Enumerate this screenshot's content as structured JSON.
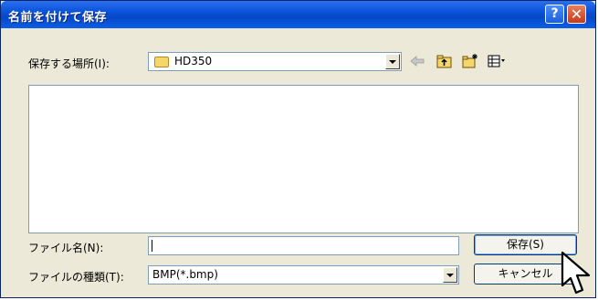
{
  "window": {
    "title": "名前を付けて保存",
    "help_glyph": "?",
    "close_glyph": "✕"
  },
  "location": {
    "label": "保存する場所(I):",
    "value": "HD350"
  },
  "filename": {
    "label": "ファイル名(N):",
    "value": ""
  },
  "filetype": {
    "label": "ファイルの種類(T):",
    "value": "BMP(*.bmp)"
  },
  "buttons": {
    "save_label": "保存(S)",
    "cancel_label": "キャンセル"
  },
  "colors": {
    "titlebar": "#0a52d8",
    "dialog_bg": "#ece9d8",
    "field_border": "#7f9db9"
  },
  "icons": [
    "back-arrow-icon",
    "up-folder-icon",
    "new-folder-icon",
    "view-menu-icon",
    "folder-icon",
    "mouse-cursor-icon"
  ]
}
